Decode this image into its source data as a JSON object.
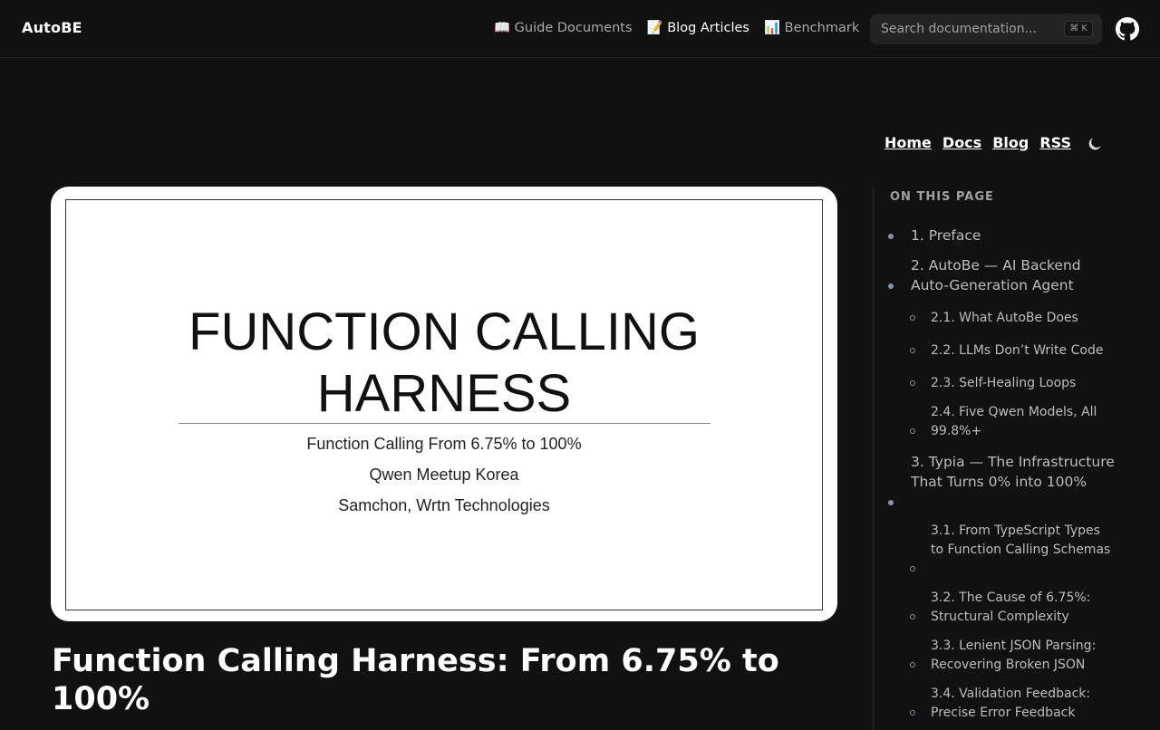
{
  "navbar": {
    "brand": "AutoBE",
    "links": [
      {
        "icon": "📖",
        "label": "Guide Documents"
      },
      {
        "icon": "📝",
        "label": "Blog Articles"
      },
      {
        "icon": "📊",
        "label": "Benchmark"
      }
    ],
    "search_placeholder": "Search documentation...",
    "search_shortcut": "⌘ K"
  },
  "header_links": [
    "Home",
    "Docs",
    "Blog",
    "RSS"
  ],
  "slide": {
    "title_line1": "FUNCTION CALLING",
    "title_line2": "HARNESS",
    "subtitle1": "Function Calling From 6.75% to 100%",
    "subtitle2": "Qwen Meetup Korea",
    "subtitle3": "Samchon, Wrtn Technologies"
  },
  "article": {
    "title_line1": "Function Calling Harness: From 6.75% to",
    "title_line2": "100%"
  },
  "toc": {
    "heading": "ON THIS PAGE",
    "items": [
      "1. Preface",
      "2. AutoBe — AI Backend Auto-Generation Agent",
      "2.1. What AutoBe Does",
      "2.2. LLMs Don’t Write Code",
      "2.3. Self-Healing Loops",
      "2.4. Five Qwen Models, All 99.8%+",
      "3. Typia — The Infrastructure That Turns 0% into 100%",
      "3.1. From TypeScript Types to Function Calling Schemas",
      "3.2. The Cause of 6.75%: Structural Complexity",
      "3.3. Lenient JSON Parsing: Recovering Broken JSON",
      "3.4. Validation Feedback: Precise Error Feedback"
    ]
  },
  "colors": {
    "background": "#111111",
    "bullet": "#8a8ea8"
  },
  "icons": {
    "github": "github-icon",
    "theme_toggle": "moon-icon"
  }
}
